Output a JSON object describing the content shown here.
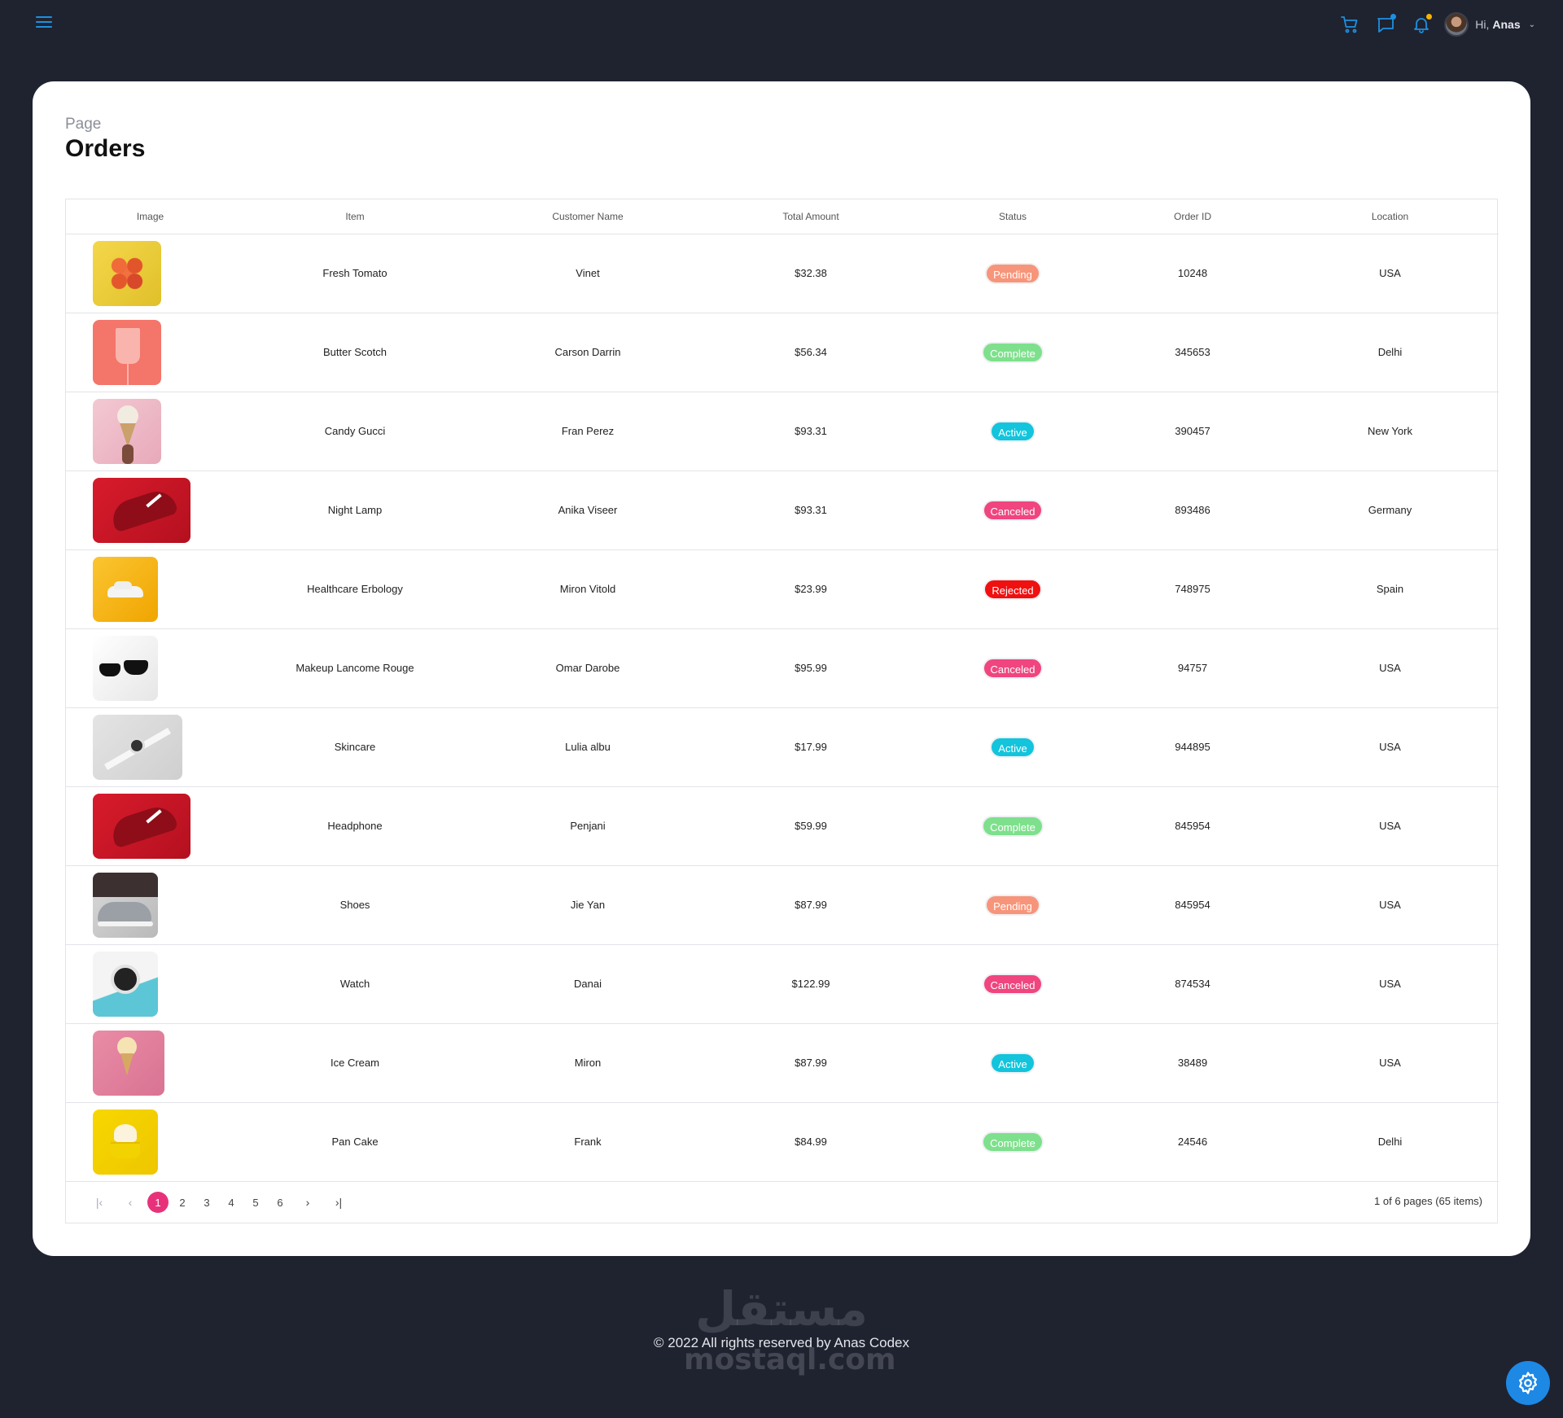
{
  "header": {
    "greeting": "Hi,",
    "user_name": "Anas",
    "icons": [
      "menu-icon",
      "cart-icon",
      "chat-icon",
      "bell-icon",
      "chevron-down-icon"
    ],
    "colors": {
      "accent": "#1e90e0",
      "chat_dot": "#1e90e0",
      "bell_dot": "#f5b400"
    }
  },
  "page": {
    "subtitle": "Page",
    "title": "Orders"
  },
  "table": {
    "headers": [
      "Image",
      "Item",
      "Customer Name",
      "Total Amount",
      "Status",
      "Order ID",
      "Location"
    ],
    "rows": [
      {
        "image": "tomatoes",
        "item": "Fresh Tomato",
        "customer": "Vinet",
        "amount": "$32.38",
        "status": "Pending",
        "order_id": "10248",
        "location": "USA"
      },
      {
        "image": "drink-cup",
        "item": "Butter Scotch",
        "customer": "Carson Darrin",
        "amount": "$56.34",
        "status": "Complete",
        "order_id": "345653",
        "location": "Delhi"
      },
      {
        "image": "ice-cream-cone",
        "item": "Candy Gucci",
        "customer": "Fran Perez",
        "amount": "$93.31",
        "status": "Active",
        "order_id": "390457",
        "location": "New York"
      },
      {
        "image": "red-sneaker",
        "item": "Night Lamp",
        "customer": "Anika Viseer",
        "amount": "$93.31",
        "status": "Canceled",
        "order_id": "893486",
        "location": "Germany"
      },
      {
        "image": "toy-car",
        "item": "Healthcare Erbology",
        "customer": "Miron Vitold",
        "amount": "$23.99",
        "status": "Rejected",
        "order_id": "748975",
        "location": "Spain"
      },
      {
        "image": "sunglasses",
        "item": "Makeup Lancome Rouge",
        "customer": "Omar Darobe",
        "amount": "$95.99",
        "status": "Canceled",
        "order_id": "94757",
        "location": "USA"
      },
      {
        "image": "smartwatch-white",
        "item": "Skincare",
        "customer": "Lulia albu",
        "amount": "$17.99",
        "status": "Active",
        "order_id": "944895",
        "location": "USA"
      },
      {
        "image": "red-sneaker",
        "item": "Headphone",
        "customer": "Penjani",
        "amount": "$59.99",
        "status": "Complete",
        "order_id": "845954",
        "location": "USA"
      },
      {
        "image": "grey-sneaker",
        "item": "Shoes",
        "customer": "Jie Yan",
        "amount": "$87.99",
        "status": "Pending",
        "order_id": "845954",
        "location": "USA"
      },
      {
        "image": "watch-blue",
        "item": "Watch",
        "customer": "Danai",
        "amount": "$122.99",
        "status": "Canceled",
        "order_id": "874534",
        "location": "USA"
      },
      {
        "image": "ice-cream-pink",
        "item": "Ice Cream",
        "customer": "Miron",
        "amount": "$87.99",
        "status": "Active",
        "order_id": "38489",
        "location": "USA"
      },
      {
        "image": "cupcake",
        "item": "Pan Cake",
        "customer": "Frank",
        "amount": "$84.99",
        "status": "Complete",
        "order_id": "24546",
        "location": "Delhi"
      }
    ],
    "status_colors": {
      "Pending": "#f7957a",
      "Complete": "#7ee08c",
      "Active": "#12c4dc",
      "Canceled": "#f0457f",
      "Rejected": "#f01010"
    }
  },
  "pagination": {
    "pages": [
      "1",
      "2",
      "3",
      "4",
      "5",
      "6"
    ],
    "current": "1",
    "first_icon": "first-page-icon",
    "prev_icon": "chevron-left-icon",
    "next_icon": "chevron-right-icon",
    "last_icon": "last-page-icon",
    "info": "1 of 6 pages (65 items)",
    "active_color": "#e7327a"
  },
  "footer": {
    "copyright": "© 2022 All rights reserved by Anas Codex",
    "watermark_ar": "مستقل",
    "watermark_en": "mostaql.com",
    "settings_icon": "gear-icon",
    "settings_color": "#1e88e5"
  }
}
